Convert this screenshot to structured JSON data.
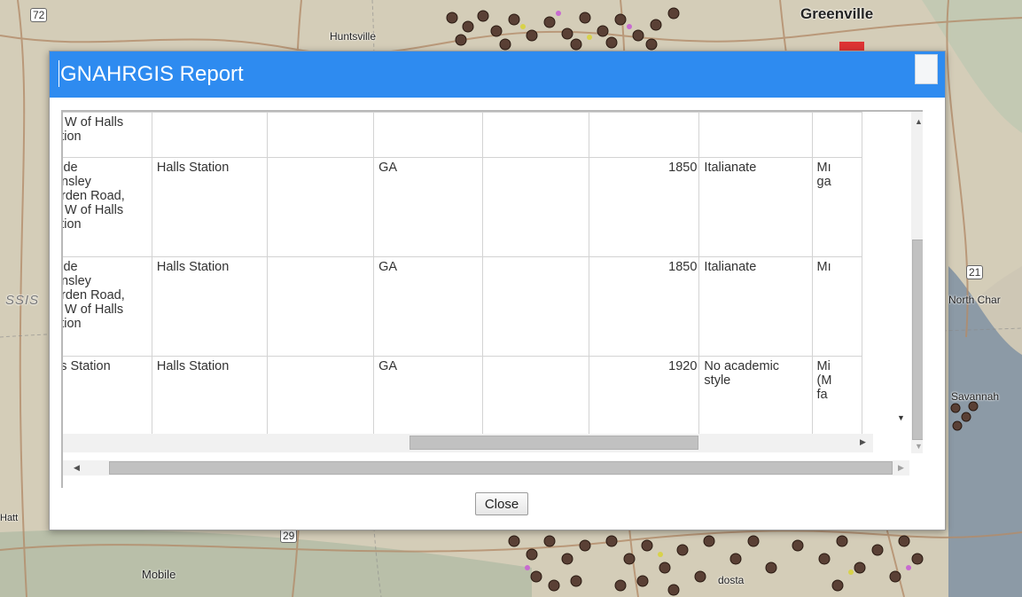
{
  "map": {
    "places": [
      "Huntsville",
      "Greenville",
      "Mobile",
      "North Char",
      "Savannah",
      "Hatt",
      "SSIS",
      "dosta"
    ],
    "route_shields": [
      "72",
      "21",
      "29"
    ]
  },
  "modal": {
    "title": "GNAHRGIS Report",
    "close_label": "Close",
    "header_color": "#2e8bf0"
  },
  "table": {
    "rows": [
      {
        "address": [
          "ı W of Halls",
          "ition"
        ],
        "city": "",
        "col3": "",
        "state": "",
        "col5": "",
        "year": "",
        "style": "",
        "notes": [
          ""
        ]
      },
      {
        "address": [
          "iide",
          "ınsley",
          "ırden Road,",
          "ı W of Halls",
          "ition"
        ],
        "city": "Halls Station",
        "col3": "",
        "state": "GA",
        "col5": "",
        "year": "1850",
        "style": "Italianate",
        "notes": [
          "Mı",
          "ga"
        ]
      },
      {
        "address": [
          "iide",
          "ınsley",
          "ırden Road,",
          "ı W of Halls",
          "ition"
        ],
        "city": "Halls Station",
        "col3": "",
        "state": "GA",
        "col5": "",
        "year": "1850",
        "style": "Italianate",
        "notes": [
          "Mı"
        ]
      },
      {
        "address": [
          "ls Station"
        ],
        "city": "Halls Station",
        "col3": "",
        "state": "GA",
        "col5": "",
        "year": "1920",
        "style": "No academic style",
        "notes": [
          "Mi",
          "(M",
          "fa"
        ]
      }
    ]
  }
}
